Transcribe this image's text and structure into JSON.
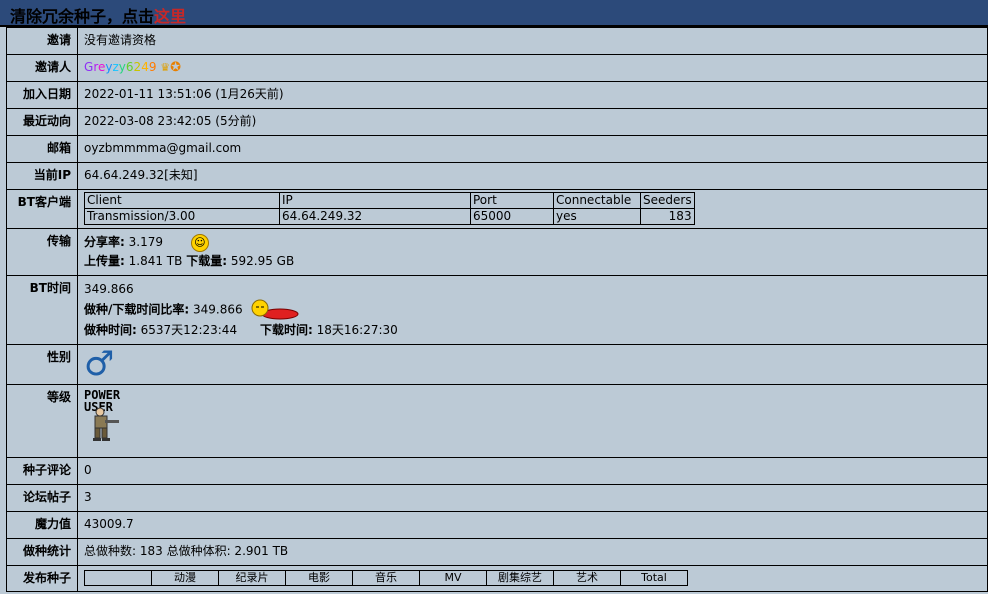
{
  "banner": {
    "text": "清除冗余种子，点击",
    "link": "这里"
  },
  "rows": {
    "invite": {
      "label": "邀请",
      "value": "没有邀请资格"
    },
    "inviter": {
      "label": "邀请人",
      "name_chars": [
        "G",
        "r",
        "e",
        "y",
        "z",
        "y",
        "6",
        "2",
        "4",
        "9"
      ],
      "name_colors": [
        "#8e2ff5",
        "#b51df2",
        "#e80fd4",
        "#1890ff",
        "#17c3ff",
        "#25d67f",
        "#62d12a",
        "#c9c400",
        "#ffb300",
        "#ff7b00"
      ]
    },
    "join_date": {
      "label": "加入日期",
      "value": "2022-01-11 13:51:06 (1月26天前)"
    },
    "last_action": {
      "label": "最近动向",
      "value": "2022-03-08 23:42:05 (5分前)"
    },
    "email": {
      "label": "邮箱",
      "value": "oyzbmmmma@gmail.com"
    },
    "ip": {
      "label": "当前IP",
      "value": "64.64.249.32[未知]"
    },
    "bt_client": {
      "label": "BT客户端",
      "headers": [
        "Client",
        "IP",
        "Port",
        "Connectable",
        "Seeders"
      ],
      "row": [
        "Transmission/3.00",
        "64.64.249.32",
        "65000",
        "yes",
        "183"
      ]
    },
    "transfer": {
      "label": "传输",
      "ratio_label": "分享率:",
      "ratio": "3.179",
      "upload_label": "上传量:",
      "upload": "1.841 TB",
      "download_label": "下载量:",
      "download": "592.95 GB"
    },
    "bt_time": {
      "label": "BT时间",
      "value": "349.866",
      "ratio_label": "做种/下载时间比率:",
      "ratio": "349.866",
      "seed_label": "做种时间:",
      "seed": "6537天12:23:44",
      "dl_label": "下载时间:",
      "dl": "18天16:27:30"
    },
    "gender": {
      "label": "性别",
      "icon": "male-symbol-icon"
    },
    "rank": {
      "label": "等级",
      "line1": "POWER",
      "line2": "USER"
    },
    "comments": {
      "label": "种子评论",
      "value": "0"
    },
    "posts": {
      "label": "论坛帖子",
      "value": "3"
    },
    "magic": {
      "label": "魔力值",
      "value": "43009.7"
    },
    "seeding_stats": {
      "label": "做种统计",
      "value": "总做种数: 183 总做种体积: 2.901 TB"
    },
    "published": {
      "label": "发布种子",
      "categories": [
        "",
        "动漫",
        "纪录片",
        "电影",
        "音乐",
        "MV",
        "剧集综艺",
        "艺术",
        "Total"
      ]
    }
  }
}
